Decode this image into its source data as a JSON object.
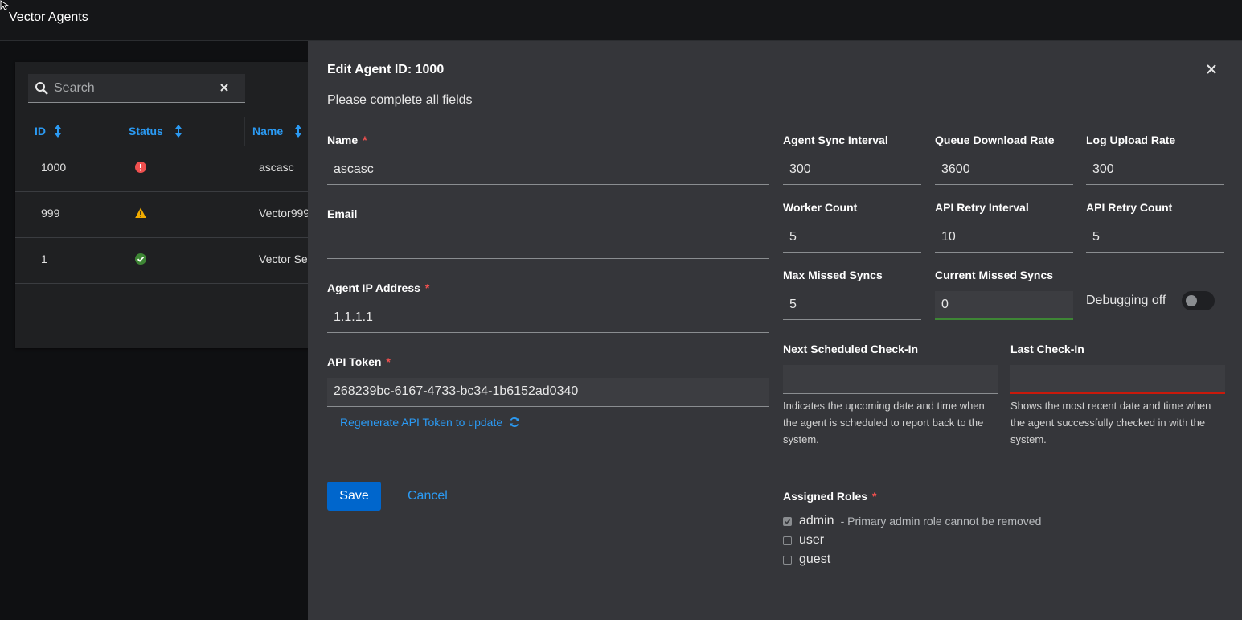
{
  "app": {
    "title": "Vector Agents"
  },
  "table": {
    "search_placeholder": "Search",
    "columns": [
      "ID",
      "Status",
      "Name"
    ],
    "rows": [
      {
        "id": "1000",
        "status": "error",
        "name": "ascasc"
      },
      {
        "id": "999",
        "status": "warning",
        "name": "Vector999"
      },
      {
        "id": "1",
        "status": "success",
        "name": "Vector Se"
      }
    ]
  },
  "modal": {
    "title": "Edit Agent ID: 1000",
    "subtitle": "Please complete all fields",
    "name": {
      "label": "Name",
      "required": "*",
      "value": "ascasc"
    },
    "email": {
      "label": "Email",
      "value": ""
    },
    "ip": {
      "label": "Agent IP Address",
      "required": "*",
      "value": "1.1.1.1"
    },
    "token": {
      "label": "API Token",
      "required": "*",
      "value": "268239bc-6167-4733-bc34-1b6152ad0340"
    },
    "regenerate_label": "Regenerate API Token to update",
    "sync_interval": {
      "label": "Agent Sync Interval",
      "value": "300"
    },
    "queue_rate": {
      "label": "Queue Download Rate",
      "value": "3600"
    },
    "log_rate": {
      "label": "Log Upload Rate",
      "value": "300"
    },
    "worker_count": {
      "label": "Worker Count",
      "value": "5"
    },
    "retry_interval": {
      "label": "API Retry Interval",
      "value": "10"
    },
    "retry_count": {
      "label": "API Retry Count",
      "value": "5"
    },
    "max_missed": {
      "label": "Max Missed Syncs",
      "value": "5"
    },
    "current_missed": {
      "label": "Current Missed Syncs",
      "value": "0"
    },
    "debugging": {
      "label": "Debugging off",
      "enabled": false
    },
    "next_checkin": {
      "label": "Next Scheduled Check-In",
      "value": "",
      "help": "Indicates the upcoming date and time when the agent is scheduled to report back to the system."
    },
    "last_checkin": {
      "label": "Last Check-In",
      "value": "",
      "help": "Shows the most recent date and time when the agent successfully checked in with the system."
    },
    "roles": {
      "label": "Assigned Roles",
      "required": "*",
      "items": [
        {
          "label": "admin",
          "checked": true,
          "note": "- Primary admin role cannot be removed"
        },
        {
          "label": "user",
          "checked": false
        },
        {
          "label": "guest",
          "checked": false
        }
      ]
    },
    "save_label": "Save",
    "cancel_label": "Cancel"
  },
  "colors": {
    "accent": "#2b9af3",
    "primary_button": "#0066cc",
    "error": "#c9190b",
    "warning": "#f0ab00",
    "success": "#3e8635"
  },
  "icons": [
    "cursor-icon",
    "search-icon",
    "clear-icon",
    "sort-icon",
    "error-icon",
    "warning-icon",
    "success-icon",
    "close-icon",
    "refresh-icon"
  ]
}
